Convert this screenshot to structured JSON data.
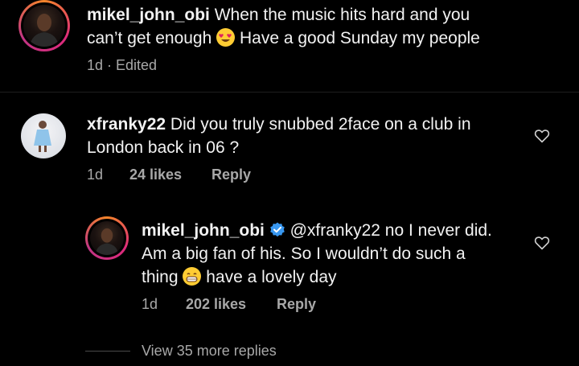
{
  "post": {
    "username": "mikel_john_obi",
    "caption_line1": "When the music hits hard and you",
    "caption_line2_start": "can’t get enough",
    "caption_line2_end": "Have a good Sunday my people",
    "meta": "1d · Edited"
  },
  "comment": {
    "username": "xfranky22",
    "text_line1": "Did you truly snubbed 2face on a club in",
    "text_line2": "London back in 06 ?",
    "time": "1d",
    "likes": "24 likes",
    "reply_label": "Reply"
  },
  "reply": {
    "username": "mikel_john_obi",
    "mention": "@xfranky22",
    "text_line1_rest": "no I never did.",
    "text_line2": "Am a big fan of his. So I wouldn’t do such a",
    "text_line3_start": "thing",
    "text_line3_end": "have a lovely day",
    "time": "1d",
    "likes": "202 likes",
    "reply_label": "Reply"
  },
  "more_replies": "View 35 more replies",
  "icons": {
    "like": "heart-icon",
    "verified": "verified-badge-icon",
    "emoji_heart_eyes": "heart-eyes-emoji-icon",
    "emoji_grin": "grin-emoji-icon"
  },
  "colors": {
    "background": "#000000",
    "text": "#f2f2f2",
    "secondary": "#a8a8a8",
    "verified": "#3897f0",
    "story_ring": "#dd2a7b"
  }
}
